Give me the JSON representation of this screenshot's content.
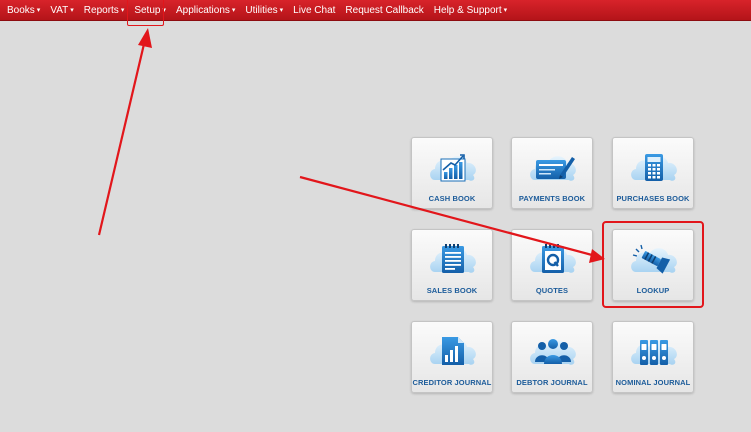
{
  "navbar": {
    "items": [
      {
        "label": "Books",
        "caret": "▾"
      },
      {
        "label": "VAT",
        "caret": "▾"
      },
      {
        "label": "Reports",
        "caret": "▾"
      },
      {
        "label": "Setup",
        "caret": "▾"
      },
      {
        "label": "Applications",
        "caret": "▾"
      },
      {
        "label": "Utilities",
        "caret": "▾"
      },
      {
        "label": "Live Chat",
        "caret": ""
      },
      {
        "label": "Request Callback",
        "caret": ""
      },
      {
        "label": "Help & Support",
        "caret": "▾"
      }
    ]
  },
  "tiles": [
    {
      "label": "CASH BOOK",
      "icon": "bar-chart-icon"
    },
    {
      "label": "PAYMENTS BOOK",
      "icon": "card-pen-icon"
    },
    {
      "label": "PURCHASES BOOK",
      "icon": "calculator-icon"
    },
    {
      "label": "SALES BOOK",
      "icon": "notepad-icon"
    },
    {
      "label": "QUOTES",
      "icon": "quote-pad-icon"
    },
    {
      "label": "LOOKUP",
      "icon": "flashlight-icon"
    },
    {
      "label": "CREDITOR JOURNAL",
      "icon": "document-chart-icon"
    },
    {
      "label": "DEBTOR JOURNAL",
      "icon": "people-icon"
    },
    {
      "label": "NOMINAL JOURNAL",
      "icon": "binders-icon"
    }
  ],
  "colors": {
    "navbar": "#c41a20",
    "background": "#dcdcdc",
    "tile_label": "#1d5c9a",
    "icon_blue": "#1f7fcf",
    "annotation_red": "#e2161b"
  }
}
